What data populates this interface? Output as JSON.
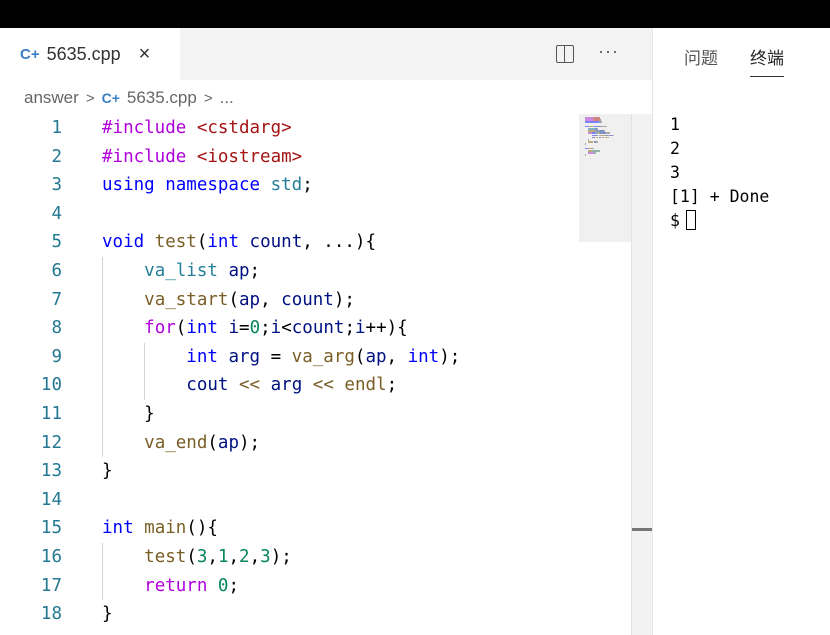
{
  "editor": {
    "tab": {
      "icon": "cpp-file-icon",
      "filename": "5635.cpp",
      "close_glyph": "×"
    },
    "actions": {
      "split_icon": "split-editor-icon",
      "more_glyph": "···"
    },
    "breadcrumb": {
      "folder": "answer",
      "file": "5635.cpp",
      "ellipsis": "..."
    },
    "lines": [
      {
        "n": "1",
        "tokens": [
          {
            "c": "pre",
            "t": "#include "
          },
          {
            "c": "str",
            "t": "<cstdarg>"
          }
        ]
      },
      {
        "n": "2",
        "tokens": [
          {
            "c": "pre",
            "t": "#include "
          },
          {
            "c": "str",
            "t": "<iostream>"
          }
        ]
      },
      {
        "n": "3",
        "tokens": [
          {
            "c": "kw",
            "t": "using "
          },
          {
            "c": "kw",
            "t": "namespace "
          },
          {
            "c": "ns",
            "t": "std"
          },
          {
            "c": "",
            "t": ";"
          }
        ]
      },
      {
        "n": "4",
        "tokens": []
      },
      {
        "n": "5",
        "tokens": [
          {
            "c": "kw",
            "t": "void "
          },
          {
            "c": "fn",
            "t": "test"
          },
          {
            "c": "",
            "t": "("
          },
          {
            "c": "kw",
            "t": "int "
          },
          {
            "c": "var",
            "t": "count"
          },
          {
            "c": "",
            "t": ", ...){"
          }
        ]
      },
      {
        "n": "6",
        "tokens": [
          {
            "c": "",
            "t": "    "
          },
          {
            "c": "ns",
            "t": "va_list "
          },
          {
            "c": "var",
            "t": "ap"
          },
          {
            "c": "",
            "t": ";"
          }
        ]
      },
      {
        "n": "7",
        "tokens": [
          {
            "c": "",
            "t": "    "
          },
          {
            "c": "fn",
            "t": "va_start"
          },
          {
            "c": "",
            "t": "("
          },
          {
            "c": "var",
            "t": "ap"
          },
          {
            "c": "",
            "t": ", "
          },
          {
            "c": "var",
            "t": "count"
          },
          {
            "c": "",
            "t": ");"
          }
        ]
      },
      {
        "n": "8",
        "tokens": [
          {
            "c": "",
            "t": "    "
          },
          {
            "c": "ctl",
            "t": "for"
          },
          {
            "c": "",
            "t": "("
          },
          {
            "c": "kw",
            "t": "int "
          },
          {
            "c": "var",
            "t": "i"
          },
          {
            "c": "",
            "t": "="
          },
          {
            "c": "num",
            "t": "0"
          },
          {
            "c": "",
            "t": ";"
          },
          {
            "c": "var",
            "t": "i"
          },
          {
            "c": "",
            "t": "<"
          },
          {
            "c": "var",
            "t": "count"
          },
          {
            "c": "",
            "t": ";"
          },
          {
            "c": "var",
            "t": "i"
          },
          {
            "c": "",
            "t": "++){"
          }
        ]
      },
      {
        "n": "9",
        "tokens": [
          {
            "c": "",
            "t": "        "
          },
          {
            "c": "kw",
            "t": "int "
          },
          {
            "c": "var",
            "t": "arg"
          },
          {
            "c": "",
            "t": " = "
          },
          {
            "c": "fn",
            "t": "va_arg"
          },
          {
            "c": "",
            "t": "("
          },
          {
            "c": "var",
            "t": "ap"
          },
          {
            "c": "",
            "t": ", "
          },
          {
            "c": "kw",
            "t": "int"
          },
          {
            "c": "",
            "t": ");"
          }
        ]
      },
      {
        "n": "10",
        "tokens": [
          {
            "c": "",
            "t": "        "
          },
          {
            "c": "var",
            "t": "cout"
          },
          {
            "c": "",
            "t": " "
          },
          {
            "c": "fn",
            "t": "<<"
          },
          {
            "c": "",
            "t": " "
          },
          {
            "c": "var",
            "t": "arg"
          },
          {
            "c": "",
            "t": " "
          },
          {
            "c": "fn",
            "t": "<<"
          },
          {
            "c": "",
            "t": " "
          },
          {
            "c": "fn",
            "t": "endl"
          },
          {
            "c": "",
            "t": ";"
          }
        ]
      },
      {
        "n": "11",
        "tokens": [
          {
            "c": "",
            "t": "    }"
          }
        ]
      },
      {
        "n": "12",
        "tokens": [
          {
            "c": "",
            "t": "    "
          },
          {
            "c": "fn",
            "t": "va_end"
          },
          {
            "c": "",
            "t": "("
          },
          {
            "c": "var",
            "t": "ap"
          },
          {
            "c": "",
            "t": ");"
          }
        ]
      },
      {
        "n": "13",
        "tokens": [
          {
            "c": "",
            "t": "}"
          }
        ]
      },
      {
        "n": "14",
        "tokens": []
      },
      {
        "n": "15",
        "tokens": [
          {
            "c": "kw",
            "t": "int "
          },
          {
            "c": "fn",
            "t": "main"
          },
          {
            "c": "",
            "t": "(){"
          }
        ]
      },
      {
        "n": "16",
        "tokens": [
          {
            "c": "",
            "t": "    "
          },
          {
            "c": "fn",
            "t": "test"
          },
          {
            "c": "",
            "t": "("
          },
          {
            "c": "num",
            "t": "3"
          },
          {
            "c": "",
            "t": ","
          },
          {
            "c": "num",
            "t": "1"
          },
          {
            "c": "",
            "t": ","
          },
          {
            "c": "num",
            "t": "2"
          },
          {
            "c": "",
            "t": ","
          },
          {
            "c": "num",
            "t": "3"
          },
          {
            "c": "",
            "t": ");"
          }
        ]
      },
      {
        "n": "17",
        "tokens": [
          {
            "c": "",
            "t": "    "
          },
          {
            "c": "ctl",
            "t": "return "
          },
          {
            "c": "num",
            "t": "0"
          },
          {
            "c": "",
            "t": ";"
          }
        ]
      },
      {
        "n": "18",
        "tokens": [
          {
            "c": "",
            "t": "}"
          }
        ]
      }
    ]
  },
  "panel": {
    "tabs": [
      {
        "label": "问题",
        "active": false
      },
      {
        "label": "终端",
        "active": true
      }
    ],
    "terminal_lines": [
      "1",
      "2",
      "3",
      "[1] + Done"
    ],
    "prompt": "$"
  },
  "colors": {
    "keyword": "#0000ff",
    "preprocessor": "#af00db",
    "string": "#a31515",
    "type": "#267f99",
    "variable": "#001080",
    "function": "#795e26",
    "number": "#098658",
    "line_number": "#237893",
    "cpp_icon": "#3a7fc4"
  }
}
